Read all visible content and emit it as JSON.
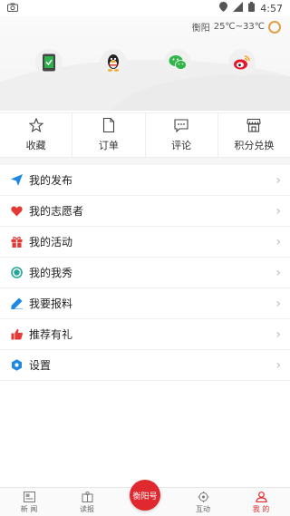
{
  "status_bar": {
    "time": "4:57"
  },
  "weather": {
    "city": "衡阳",
    "temp": "25℃~33℃",
    "icon": "sun-cloud-icon"
  },
  "social_logins": [
    {
      "name": "phone-login-icon",
      "color": "#2bb24c"
    },
    {
      "name": "qq-icon",
      "color": "#f5a623"
    },
    {
      "name": "wechat-icon",
      "color": "#32b64a"
    },
    {
      "name": "weibo-icon",
      "color": "#e6162d"
    }
  ],
  "quick_actions": [
    {
      "label": "收藏",
      "icon": "star-icon"
    },
    {
      "label": "订单",
      "icon": "document-icon"
    },
    {
      "label": "评论",
      "icon": "comment-icon"
    },
    {
      "label": "积分兑换",
      "icon": "store-icon"
    }
  ],
  "menu": [
    {
      "label": "我的发布",
      "icon": "send-icon",
      "color": "#1e88e5"
    },
    {
      "label": "我的志愿者",
      "icon": "heart-icon",
      "color": "#e53935"
    },
    {
      "label": "我的活动",
      "icon": "gift-icon",
      "color": "#e53935"
    },
    {
      "label": "我的我秀",
      "icon": "circle-icon",
      "color": "#26a69a"
    },
    {
      "label": "我要报料",
      "icon": "pencil-icon",
      "color": "#1e88e5"
    },
    {
      "label": "推荐有礼",
      "icon": "thumbs-up-icon",
      "color": "#e53935"
    },
    {
      "label": "设置",
      "icon": "settings-icon",
      "color": "#1e88e5"
    }
  ],
  "bottom_nav": [
    {
      "label": "新 闻",
      "icon": "news-icon"
    },
    {
      "label": "读报",
      "icon": "newspaper-icon"
    },
    {
      "label": "衡阳号",
      "icon": "center-button"
    },
    {
      "label": "互动",
      "icon": "interact-icon"
    },
    {
      "label": "我 的",
      "icon": "user-icon"
    }
  ],
  "accent_color": "#e0292e"
}
